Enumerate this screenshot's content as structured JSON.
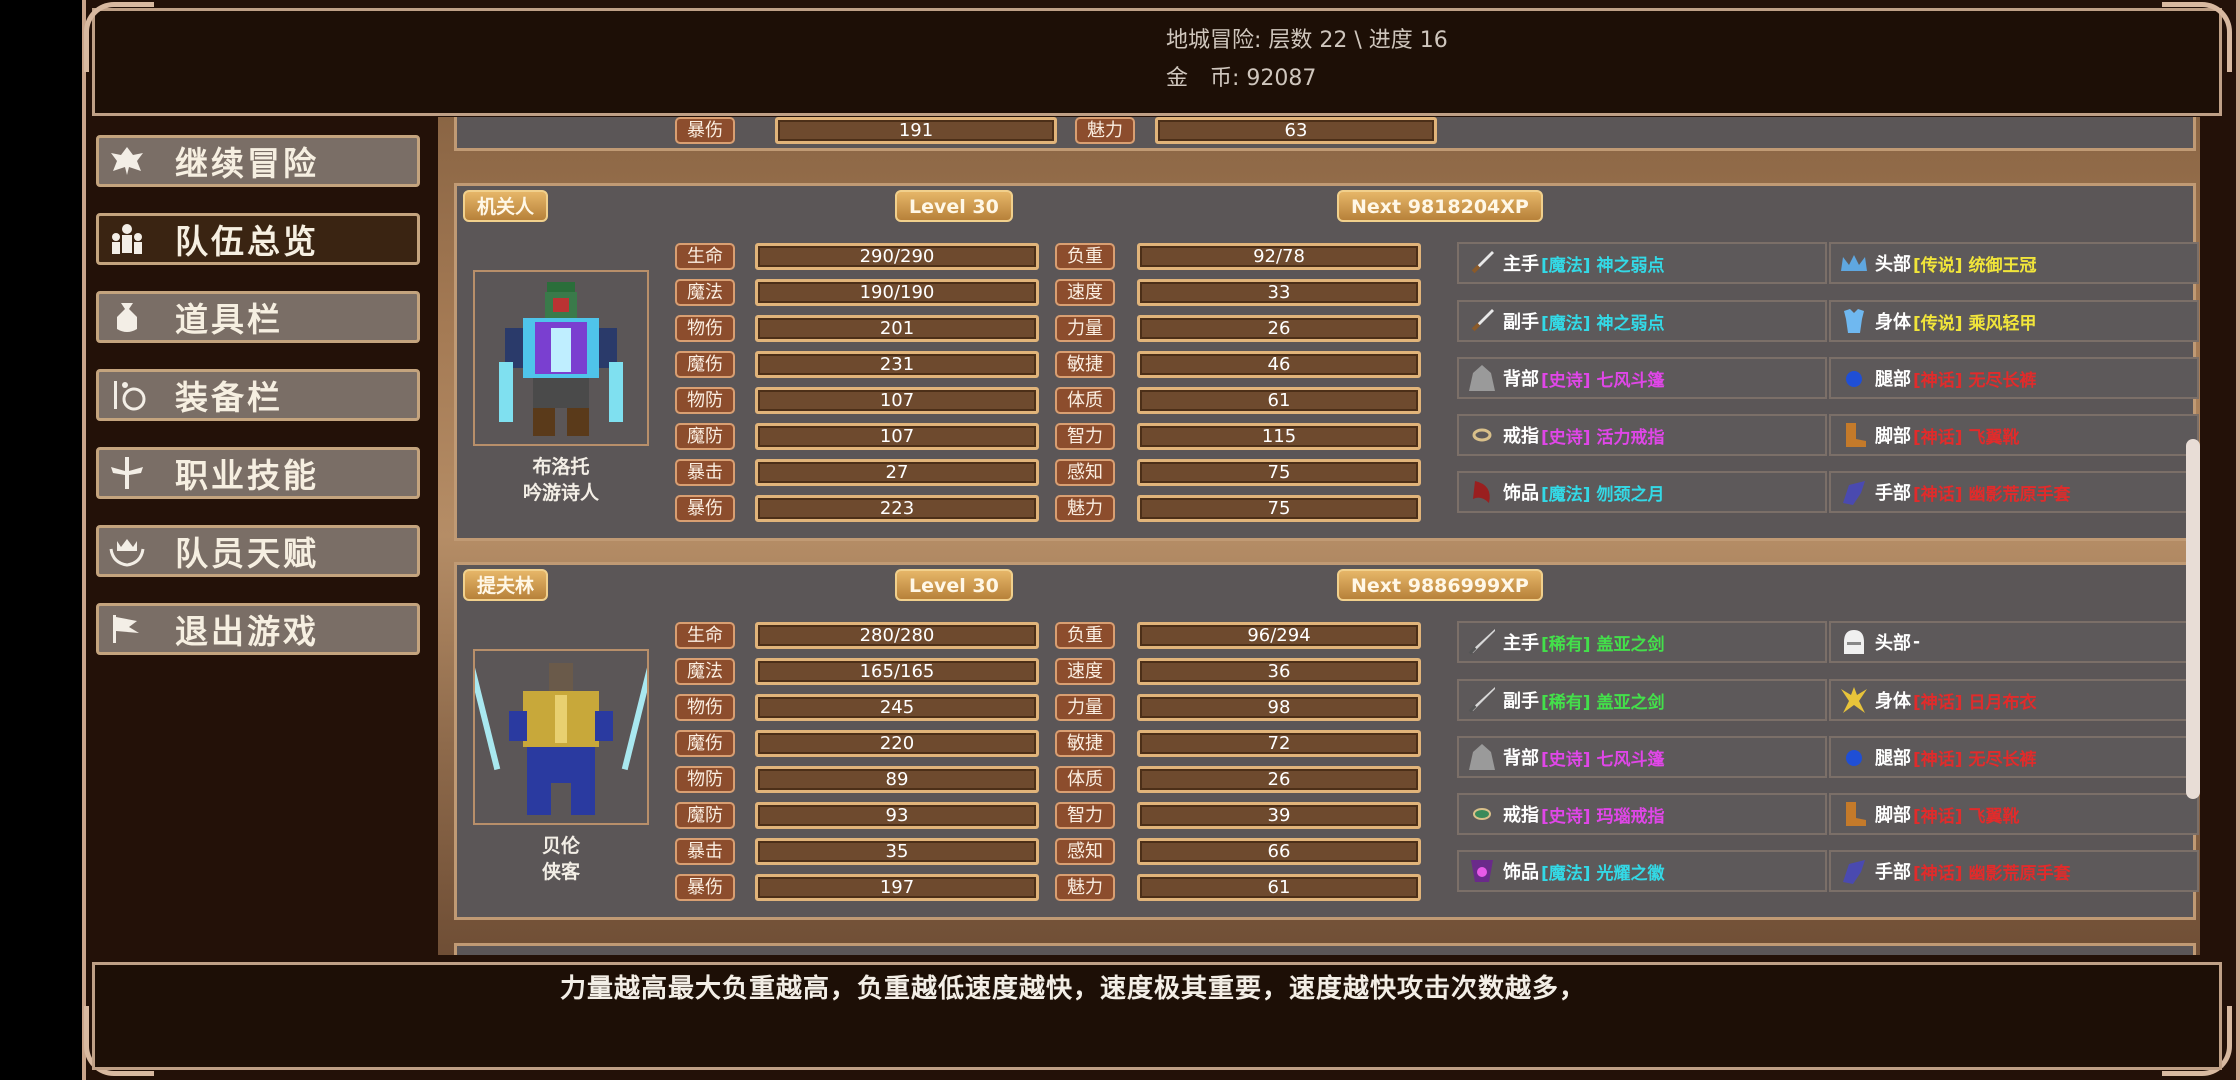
{
  "header": {
    "dungeon_label": "地城冒险: 层数 22 \\ 进度 16",
    "gold_label": "金　币:",
    "gold_value": "92087"
  },
  "sidebar": {
    "items": [
      {
        "label": "继续冒险",
        "icon": "dragon-icon"
      },
      {
        "label": "队伍总览",
        "icon": "party-icon"
      },
      {
        "label": "道具栏",
        "icon": "bag-icon"
      },
      {
        "label": "装备栏",
        "icon": "equipment-icon"
      },
      {
        "label": "职业技能",
        "icon": "sword-wings-icon"
      },
      {
        "label": "队员天赋",
        "icon": "laurel-crown-icon"
      },
      {
        "label": "退出游戏",
        "icon": "exit-flag-icon"
      }
    ]
  },
  "partial_top": {
    "stat_a_label": "暴伤",
    "stat_a_value": "191",
    "stat_b_label": "魅力",
    "stat_b_value": "63"
  },
  "members": [
    {
      "title": "机关人",
      "level": "Level 30",
      "next_xp": "Next 9818204XP",
      "name": "布洛托",
      "class": "吟游诗人",
      "stats_left": [
        {
          "label": "生命",
          "value": "290/290"
        },
        {
          "label": "魔法",
          "value": "190/190"
        },
        {
          "label": "物伤",
          "value": "201"
        },
        {
          "label": "魔伤",
          "value": "231"
        },
        {
          "label": "物防",
          "value": "107"
        },
        {
          "label": "魔防",
          "value": "107"
        },
        {
          "label": "暴击",
          "value": "27"
        },
        {
          "label": "暴伤",
          "value": "223"
        }
      ],
      "stats_right": [
        {
          "label": "负重",
          "value": "92/78"
        },
        {
          "label": "速度",
          "value": "33"
        },
        {
          "label": "力量",
          "value": "26"
        },
        {
          "label": "敏捷",
          "value": "46"
        },
        {
          "label": "体质",
          "value": "61"
        },
        {
          "label": "智力",
          "value": "115"
        },
        {
          "label": "感知",
          "value": "75"
        },
        {
          "label": "魅力",
          "value": "75"
        }
      ],
      "equipment": [
        {
          "slot": "主手",
          "item": "[魔法] 神之弱点",
          "rarity": "magic",
          "icon": "dagger-icon"
        },
        {
          "slot": "头部",
          "item": "[传说] 统御王冠",
          "rarity": "legend",
          "icon": "crown-icon"
        },
        {
          "slot": "副手",
          "item": "[魔法] 神之弱点",
          "rarity": "magic",
          "icon": "dagger-icon"
        },
        {
          "slot": "身体",
          "item": "[传说] 乘风轻甲",
          "rarity": "legend",
          "icon": "armor-icon"
        },
        {
          "slot": "背部",
          "item": "[史诗] 七风斗篷",
          "rarity": "epic",
          "icon": "cloak-icon"
        },
        {
          "slot": "腿部",
          "item": "[神话] 无尽长裤",
          "rarity": "myth",
          "icon": "pants-icon"
        },
        {
          "slot": "戒指",
          "item": "[史诗] 活力戒指",
          "rarity": "epic",
          "icon": "ring-icon"
        },
        {
          "slot": "脚部",
          "item": "[神话] 飞翼靴",
          "rarity": "myth",
          "icon": "boots-icon"
        },
        {
          "slot": "饰品",
          "item": "[魔法] 刎颈之月",
          "rarity": "magic",
          "icon": "amulet-icon"
        },
        {
          "slot": "手部",
          "item": "[神话] 幽影荒原手套",
          "rarity": "myth",
          "icon": "gloves-icon"
        }
      ]
    },
    {
      "title": "提夫林",
      "level": "Level 30",
      "next_xp": "Next 9886999XP",
      "name": "贝伦",
      "class": "侠客",
      "stats_left": [
        {
          "label": "生命",
          "value": "280/280"
        },
        {
          "label": "魔法",
          "value": "165/165"
        },
        {
          "label": "物伤",
          "value": "245"
        },
        {
          "label": "魔伤",
          "value": "220"
        },
        {
          "label": "物防",
          "value": "89"
        },
        {
          "label": "魔防",
          "value": "93"
        },
        {
          "label": "暴击",
          "value": "35"
        },
        {
          "label": "暴伤",
          "value": "197"
        }
      ],
      "stats_right": [
        {
          "label": "负重",
          "value": "96/294"
        },
        {
          "label": "速度",
          "value": "36"
        },
        {
          "label": "力量",
          "value": "98"
        },
        {
          "label": "敏捷",
          "value": "72"
        },
        {
          "label": "体质",
          "value": "26"
        },
        {
          "label": "智力",
          "value": "39"
        },
        {
          "label": "感知",
          "value": "66"
        },
        {
          "label": "魅力",
          "value": "61"
        }
      ],
      "equipment": [
        {
          "slot": "主手",
          "item": "[稀有] 盖亚之剑",
          "rarity": "rare",
          "icon": "sword-icon"
        },
        {
          "slot": "头部",
          "item": "-",
          "rarity": "none",
          "icon": "helmet-icon"
        },
        {
          "slot": "副手",
          "item": "[稀有] 盖亚之剑",
          "rarity": "rare",
          "icon": "sword-icon"
        },
        {
          "slot": "身体",
          "item": "[神话] 日月布衣",
          "rarity": "myth",
          "icon": "robe-icon"
        },
        {
          "slot": "背部",
          "item": "[史诗] 七风斗篷",
          "rarity": "epic",
          "icon": "cloak-icon"
        },
        {
          "slot": "腿部",
          "item": "[神话] 无尽长裤",
          "rarity": "myth",
          "icon": "pants-icon"
        },
        {
          "slot": "戒指",
          "item": "[史诗] 玛瑙戒指",
          "rarity": "epic",
          "icon": "ring-icon"
        },
        {
          "slot": "脚部",
          "item": "[神话] 飞翼靴",
          "rarity": "myth",
          "icon": "boots-icon"
        },
        {
          "slot": "饰品",
          "item": "[魔法] 光耀之徽",
          "rarity": "magic",
          "icon": "badge-icon"
        },
        {
          "slot": "手部",
          "item": "[神话] 幽影荒原手套",
          "rarity": "myth",
          "icon": "gloves-icon"
        }
      ]
    }
  ],
  "hint": "力量越高最大负重越高，负重越低速度越快，速度极其重要，速度越快攻击次数越多，"
}
